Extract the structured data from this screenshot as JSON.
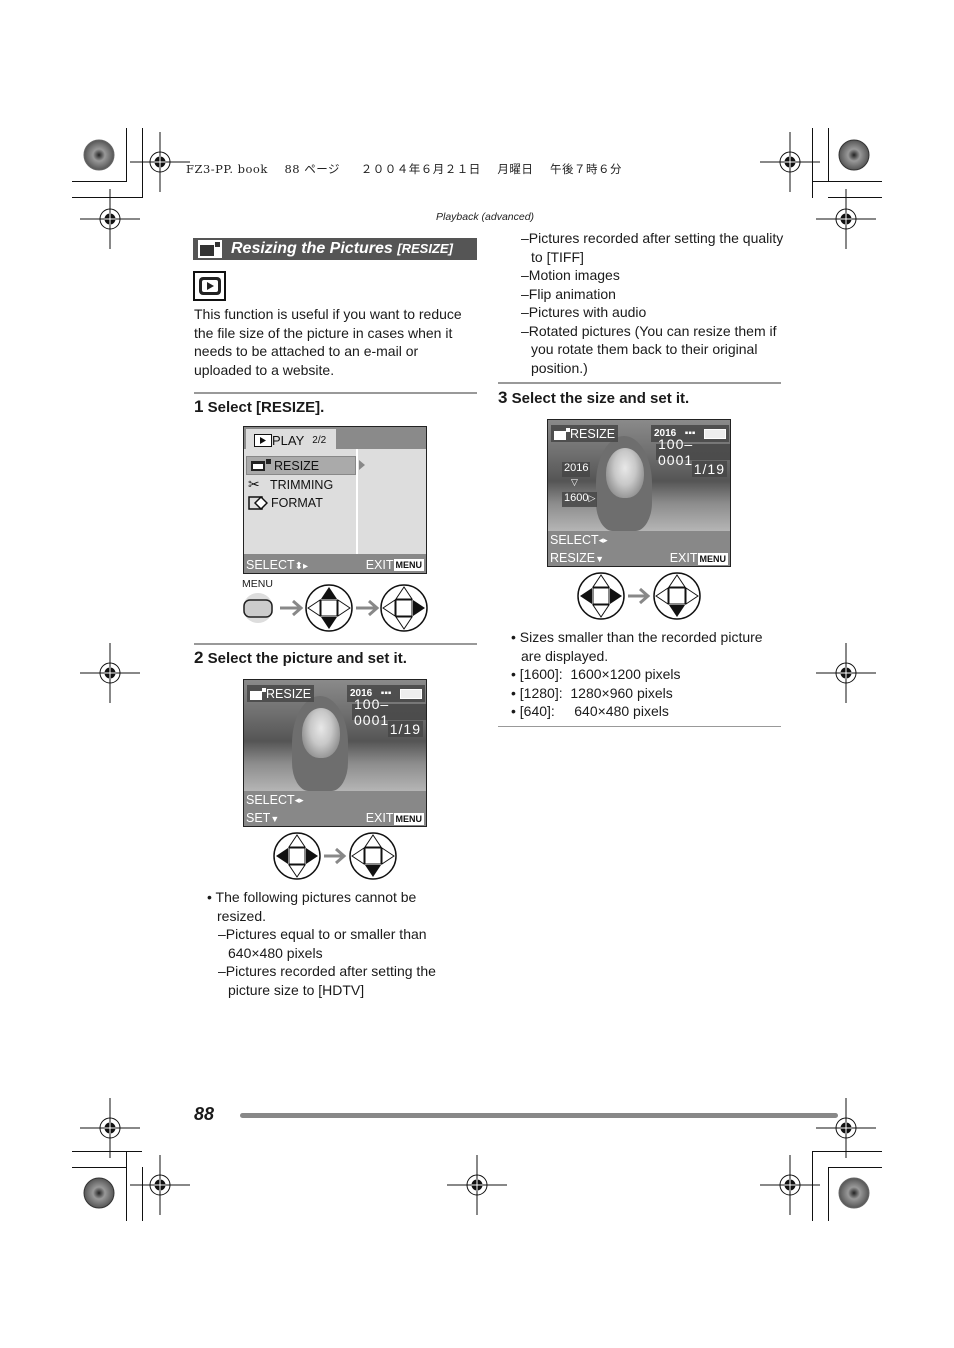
{
  "print_header": {
    "file": "FZ3-PP. book",
    "page_ref": "88 ページ",
    "date": "２００４年６月２１日",
    "weekday": "月曜日",
    "time": "午後７時６分"
  },
  "section_label": "Playback (advanced)",
  "title": {
    "text": "Resizing the Pictures",
    "tag": "[RESIZE]",
    "icon": "resize-icon"
  },
  "mode_icon": "playback-mode-icon",
  "intro": "This function is useful if you want to reduce the file size of the picture in cases when it needs to be attached to an e-mail or uploaded to a website.",
  "steps": [
    {
      "number": "1",
      "label": "Select [RESIZE].",
      "lcd": {
        "tab_label": "PLAY",
        "page": "2/2",
        "items": [
          {
            "label": "RESIZE",
            "icon": "resize-icon",
            "selected": true
          },
          {
            "label": "TRIMMING",
            "icon": "scissors-icon",
            "selected": false
          },
          {
            "label": "FORMAT",
            "icon": "format-icon",
            "selected": false
          }
        ],
        "footer_left": "SELECT",
        "footer_right": "EXIT",
        "menu_badge": "MENU"
      },
      "controls": {
        "button_label": "MENU",
        "sequence": [
          "menu-button",
          "up-down-pad",
          "right-pad"
        ]
      }
    },
    {
      "number": "2",
      "label": "Select the picture and set it.",
      "lcd": {
        "mode": "RESIZE",
        "size": "2016",
        "file_no": "100–0001",
        "count": "1/19",
        "footer_line1": "SELECT",
        "footer_line2": "SET",
        "footer_right": "EXIT",
        "menu_badge": "MENU"
      },
      "controls": {
        "sequence": [
          "left-right-pad",
          "down-pad"
        ]
      }
    },
    {
      "number": "3",
      "label": "Select the size and set it.",
      "lcd": {
        "mode": "RESIZE",
        "size": "2016",
        "file_no": "100–0001",
        "count": "1/19",
        "from_size": "2016",
        "to_size": "1600",
        "footer_line1": "SELECT",
        "footer_line2": "RESIZE",
        "footer_right": "EXIT",
        "menu_badge": "MENU"
      },
      "controls": {
        "sequence": [
          "left-right-pad",
          "down-pad"
        ]
      }
    }
  ],
  "cannot_resize": {
    "intro": "The following pictures cannot be resized.",
    "items": [
      "–Pictures equal to or smaller than 640×480 pixels",
      "–Pictures recorded after setting the picture size to [HDTV]",
      "–Pictures recorded after setting the quality to [TIFF]",
      "–Motion images",
      "–Flip animation",
      "–Pictures with audio",
      "–Rotated pictures (You can resize them if you rotate them back to their original position.)"
    ]
  },
  "size_notes": [
    "Sizes smaller than the recorded picture are displayed.",
    "[1600]:  1600×1200 pixels",
    "[1280]:  1280×960 pixels",
    "[640]:     640×480 pixels"
  ],
  "page_number": "88"
}
